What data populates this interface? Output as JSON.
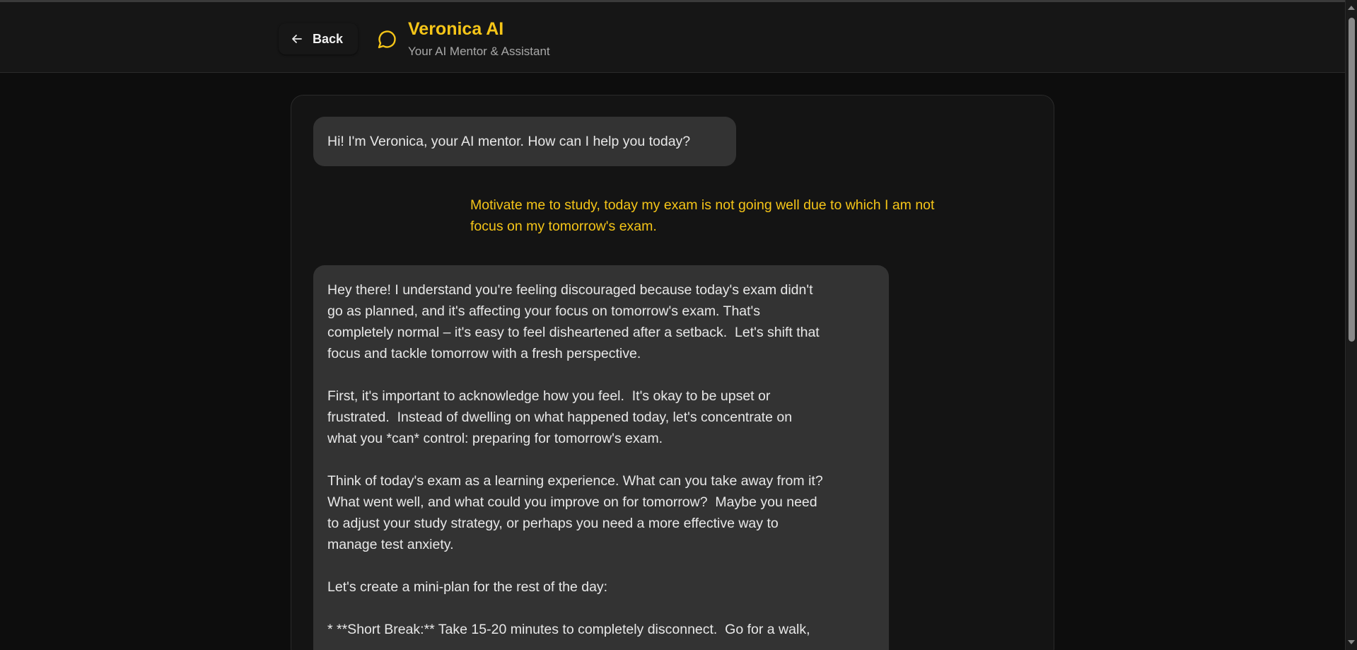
{
  "header": {
    "back_label": "Back",
    "title": "Veronica AI",
    "subtitle": "Your AI Mentor & Assistant",
    "icons": {
      "back": "arrow-left-icon",
      "chat": "message-circle-icon"
    },
    "accent_color": "#f5c518"
  },
  "chat": {
    "messages": [
      {
        "role": "assistant",
        "paragraphs": [
          "Hi! I'm Veronica, your AI mentor. How can I help you today?"
        ]
      },
      {
        "role": "user",
        "text": "Motivate me to study, today my exam is not going well due to which I am not\nfocus on my tomorrow's exam."
      },
      {
        "role": "assistant",
        "paragraphs": [
          "Hey there! I understand you're feeling discouraged because today's exam didn't\ngo as planned, and it's affecting your focus on tomorrow's exam. That's\ncompletely normal – it's easy to feel disheartened after a setback.  Let's shift that\nfocus and tackle tomorrow with a fresh perspective.",
          "First, it's important to acknowledge how you feel.  It's okay to be upset or\nfrustrated.  Instead of dwelling on what happened today, let's concentrate on\nwhat you *can* control: preparing for tomorrow's exam.",
          "Think of today's exam as a learning experience. What can you take away from it?\nWhat went well, and what could you improve on for tomorrow?  Maybe you need\nto adjust your study strategy, or perhaps you need a more effective way to\nmanage test anxiety.",
          "Let's create a mini-plan for the rest of the day:",
          "* **Short Break:** Take 15-20 minutes to completely disconnect.  Go for a walk,"
        ]
      }
    ]
  }
}
